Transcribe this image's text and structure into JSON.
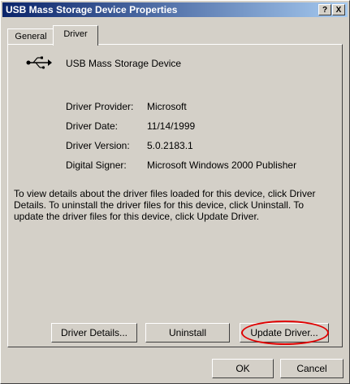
{
  "window": {
    "title": "USB Mass Storage Device Properties",
    "help_button": "?",
    "close_button": "X"
  },
  "tabs": [
    {
      "label": "General"
    },
    {
      "label": "Driver"
    }
  ],
  "device": {
    "name": "USB Mass Storage Device",
    "icon": "usb-icon"
  },
  "driver_info": [
    {
      "label": "Driver Provider:",
      "value": "Microsoft"
    },
    {
      "label": "Driver Date:",
      "value": "11/14/1999"
    },
    {
      "label": "Driver Version:",
      "value": "5.0.2183.1"
    },
    {
      "label": "Digital Signer:",
      "value": "Microsoft Windows 2000 Publisher"
    }
  ],
  "description": "To view details about the driver files loaded for this device, click Driver Details. To uninstall the driver files for this device, click Uninstall. To update the driver files for this device, click Update Driver.",
  "actions": {
    "details_label": "Driver Details...",
    "uninstall_label": "Uninstall",
    "update_label": "Update Driver..."
  },
  "dialog_buttons": {
    "ok_label": "OK",
    "cancel_label": "Cancel"
  },
  "colors": {
    "title_active": "#0a246a",
    "highlight": "#e00000",
    "face": "#d4d0c8"
  }
}
